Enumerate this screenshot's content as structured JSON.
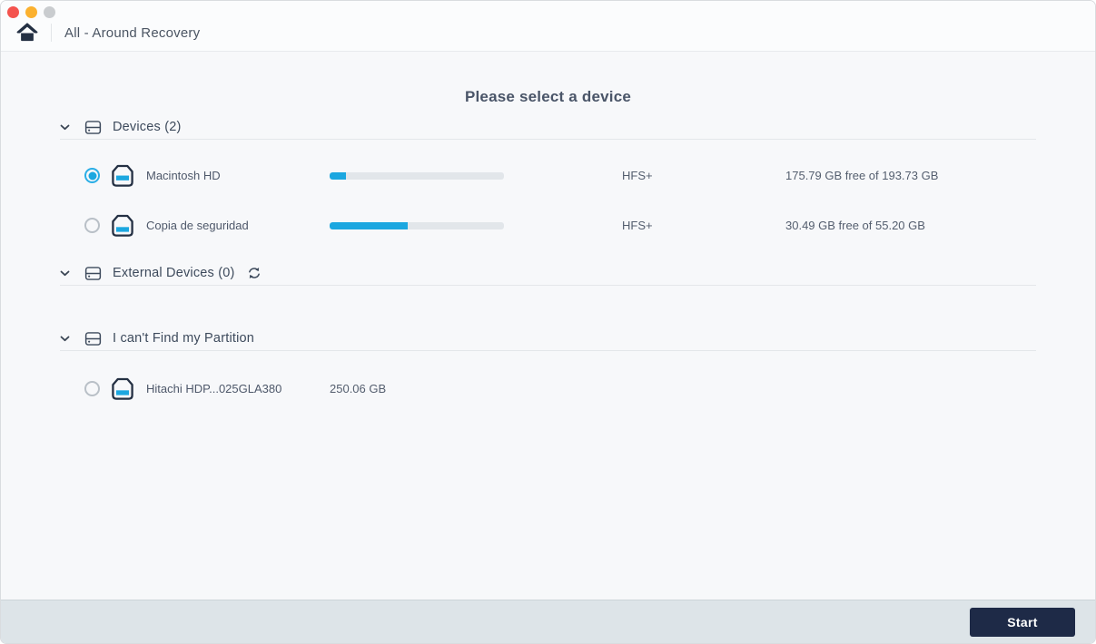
{
  "titlebar": {
    "title": "All - Around Recovery",
    "traffic_lights": {
      "close": "#f4534e",
      "minimize": "#fbb12f",
      "zoom": "#c9cccf"
    }
  },
  "heading": "Please select a device",
  "sections": [
    {
      "label": "Devices (2)"
    },
    {
      "label": "External Devices (0)"
    },
    {
      "label": "I can't Find my Partition"
    }
  ],
  "devices": [
    {
      "name": "Macintosh HD",
      "selected": true,
      "used_percent": 9.3,
      "filesystem": "HFS+",
      "free_info": "175.79 GB free of 193.73 GB"
    },
    {
      "name": "Copia de seguridad",
      "selected": false,
      "used_percent": 44.8,
      "filesystem": "HFS+",
      "free_info": "30.49 GB free of 55.20 GB"
    }
  ],
  "partitions": [
    {
      "name": "Hitachi HDP...025GLA380",
      "selected": false,
      "size": "250.06 GB"
    }
  ],
  "footer": {
    "start_label": "Start"
  },
  "colors": {
    "accent_blue": "#1ba7e0",
    "dark_navy": "#1e2a47",
    "icon_outline": "#243043"
  }
}
